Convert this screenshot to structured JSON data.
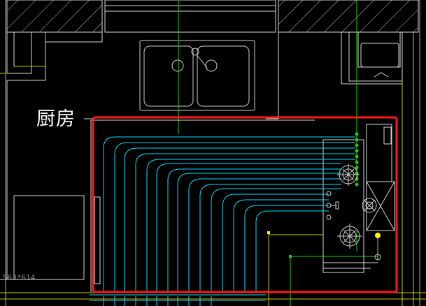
{
  "plan": {
    "room_label": "厨房",
    "dimension_note": "563*614"
  },
  "colors": {
    "background": "#000000",
    "wall": "#d8d8d8",
    "wall_hatch": "#c8c8c8",
    "structure": "#c9c900",
    "pipe": "#00e0ff",
    "gridline": "#19d000",
    "highlight_box": "#ff1a1a",
    "fixture": "#cfcfcf",
    "valve_yellow": "#ffff00"
  },
  "icons": [
    "sink-icon",
    "faucet-icon",
    "gas-burner-icon",
    "valve-icon",
    "distribution-manifold-icon"
  ]
}
